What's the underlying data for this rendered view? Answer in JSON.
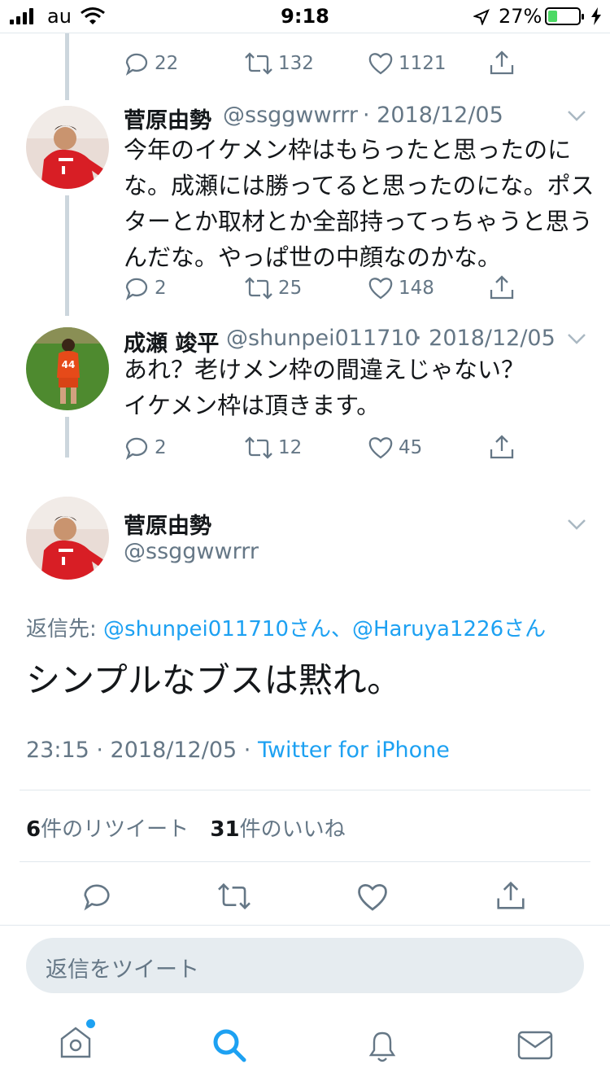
{
  "status_bar": {
    "carrier": "au",
    "time": "9:18",
    "battery": "27%"
  },
  "thread": [
    {
      "actions": {
        "replies": "22",
        "retweets": "132",
        "likes": "1121"
      }
    },
    {
      "name": "菅原由勢",
      "handle": "@ssggwwrrr",
      "date": "· 2018/12/05",
      "text_lines": [
        "今年のイケメン枠はもらったと思ったのに",
        "な。成瀬には勝ってると思ったのにな。ポス",
        "ターとか取材とか全部持ってっちゃうと思う",
        "んだな。やっぱ世の中顔なのかな。"
      ],
      "actions": {
        "replies": "2",
        "retweets": "25",
        "likes": "148"
      }
    },
    {
      "name": "成瀬 竣平",
      "handle": "@shunpei011710",
      "date": "· 2018/12/05",
      "text_lines": [
        "あれ？老けメン枠の間違えじゃない？",
        "イケメン枠は頂きます。"
      ],
      "actions": {
        "replies": "2",
        "retweets": "12",
        "likes": "45"
      }
    }
  ],
  "main_tweet": {
    "name": "菅原由勢",
    "handle": "@ssggwwrrr",
    "reply_to_label": "返信先:",
    "reply_to_users": "@shunpei011710さん、@Haruya1226さん",
    "text": "シンプルなブスは黙れ。",
    "timestamp": "23:15 · 2018/12/05 ·",
    "source": "Twitter for iPhone",
    "retweet_count": "6",
    "retweet_label": "件のリツイート",
    "like_count": "31",
    "like_label": "件のいいね"
  },
  "reply_box": {
    "placeholder": "返信をツイート"
  },
  "tab_bar": {
    "icons": [
      "home-icon",
      "search-icon",
      "notifications-icon",
      "messages-icon"
    ]
  },
  "colors": {
    "accent": "#1da1f2",
    "muted": "#657786",
    "battery": "#4cd964"
  }
}
